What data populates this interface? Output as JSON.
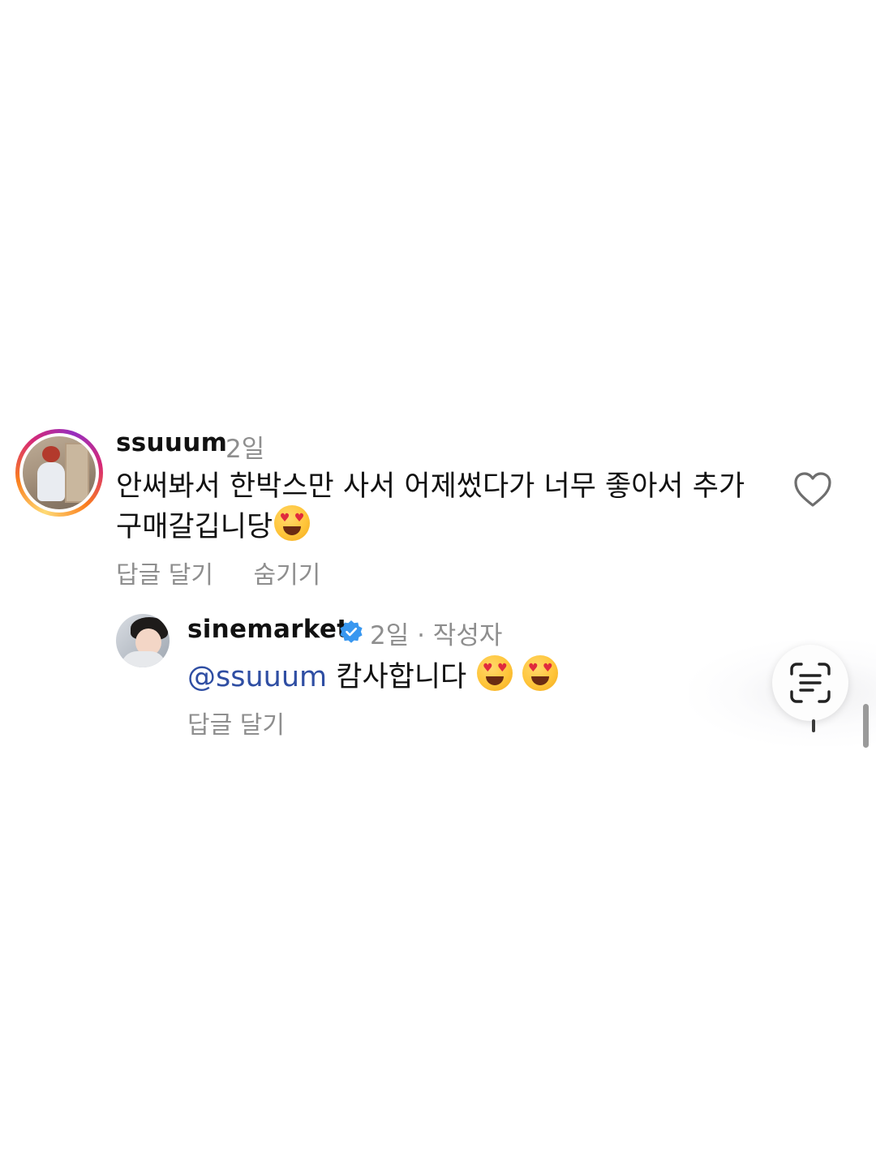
{
  "parent_comment": {
    "username": "ssuuum",
    "time": "2일",
    "text": "안써봐서 한박스만 사서 어제썼다가 너무 좋아서 추가구매갈깁니당",
    "emoji": "smiling-face-with-heart-eyes",
    "actions": {
      "reply_label": "답글 달기",
      "hide_label": "숨기기"
    },
    "like_icon": "heart-outline-icon"
  },
  "reply": {
    "username": "sinemarket",
    "verified_icon": "verified-badge-icon",
    "meta": "2일 · 작성자",
    "mention": "@ssuuum",
    "text": " 캄사합니다 ",
    "emojis": [
      "smiling-face-with-heart-eyes",
      "smiling-face-with-heart-eyes"
    ],
    "actions": {
      "reply_label": "답글 달기"
    }
  },
  "overlay": {
    "scan_icon": "live-text-scan-icon"
  },
  "colors": {
    "secondary_text": "#8e8e8e",
    "mention": "#2f4ea3",
    "verified": "#3897f0",
    "story_ring": [
      "#feda75",
      "#fa7e1e",
      "#d62976",
      "#962fbf"
    ]
  }
}
